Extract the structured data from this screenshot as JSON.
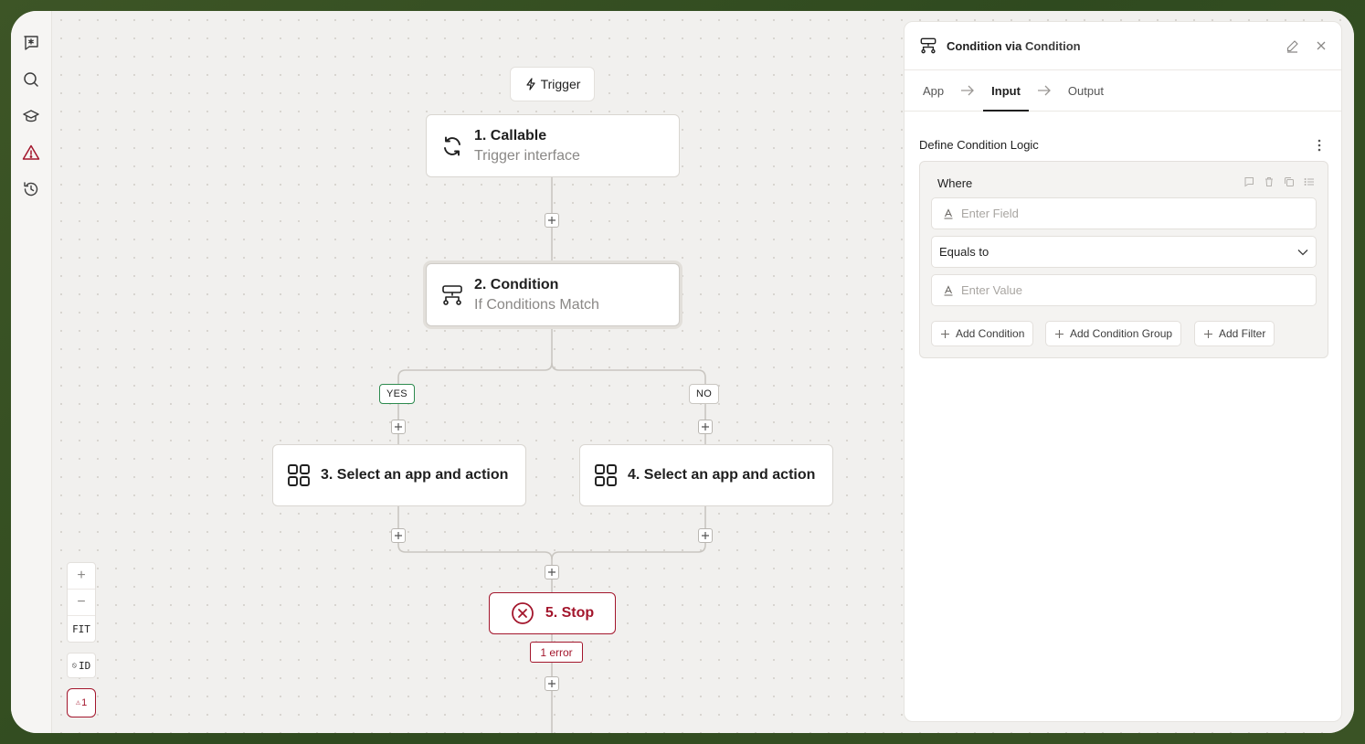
{
  "canvas": {
    "trigger_pill": "Trigger",
    "nodes": {
      "callable": {
        "title": "1. Callable",
        "subtitle": "Trigger interface"
      },
      "condition": {
        "title": "2. Condition",
        "subtitle": "If Conditions Match"
      },
      "yes_action": {
        "title": "3. Select an app and action"
      },
      "no_action": {
        "title": "4. Select an app and action"
      },
      "stop": {
        "title": "5. Stop",
        "error_badge": "1 error"
      }
    },
    "branches": {
      "yes": "YES",
      "no": "NO"
    },
    "controls": {
      "zoom_in": "+",
      "zoom_out": "−",
      "fit": "FIT",
      "id_toggle": "ID",
      "error_count": "1"
    }
  },
  "panel": {
    "title_prefix": "Condition via",
    "title_suffix": "Condition",
    "tabs": [
      {
        "label": "App"
      },
      {
        "label": "Input"
      },
      {
        "label": "Output"
      }
    ],
    "active_tab": "Input",
    "section_title": "Define Condition Logic",
    "where_label": "Where",
    "field_placeholder": "Enter Field",
    "operator": "Equals to",
    "value_placeholder": "Enter Value",
    "buttons": {
      "add_condition": "Add Condition",
      "add_condition_group": "Add Condition Group",
      "add_filter": "Add Filter"
    }
  },
  "colors": {
    "accent_error": "#a3162c",
    "yes_green": "#2d8a4e",
    "frame_bg": "#3d5526"
  }
}
